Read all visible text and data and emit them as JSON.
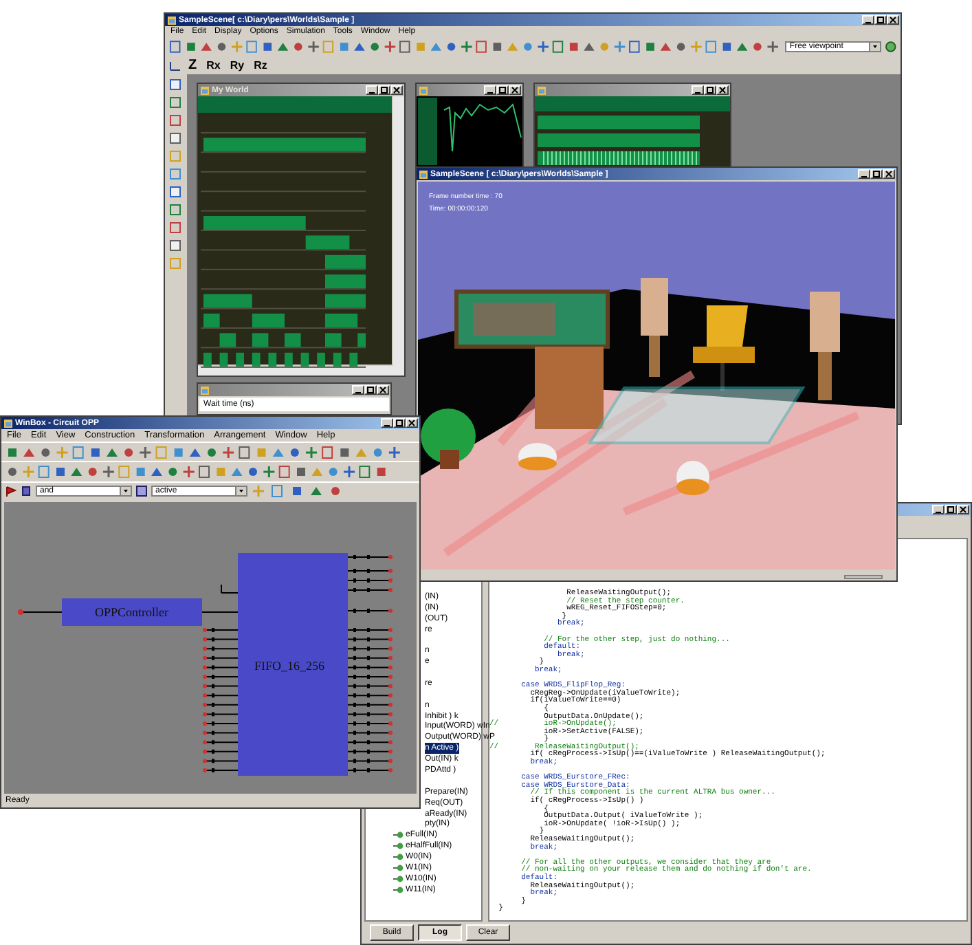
{
  "sim_window": {
    "title": "SampleScene[ c:\\Diary\\pers\\Worlds\\Sample ]",
    "menu": [
      "File",
      "Edit",
      "Display",
      "Options",
      "Simulation",
      "Tools",
      "Window",
      "Help"
    ],
    "viewpoint": "Free viewpoint",
    "axis_buttons": [
      "Z",
      "Rx",
      "Ry",
      "Rz"
    ],
    "wave_window": {
      "title": "My World"
    },
    "watch_panel": {
      "row": "Wait time (ns)"
    }
  },
  "scene_window": {
    "title": "SampleScene [ c:\\Diary\\pers\\Worlds\\Sample ]",
    "overlay": [
      "Frame number time : 70",
      "Time: 00:00:00:120"
    ]
  },
  "code_window": {
    "tree": [
      {
        "label": "(IN)",
        "kind": "label",
        "selected": false
      },
      {
        "label": "(IN)",
        "kind": "label",
        "selected": false
      },
      {
        "label": "(OUT)",
        "kind": "label",
        "selected": false
      },
      {
        "label": "re",
        "kind": "label",
        "selected": false
      },
      {
        "label": "n",
        "kind": "label",
        "selected": false,
        "space_before": true
      },
      {
        "label": "e",
        "kind": "label",
        "selected": false
      },
      {
        "label": "re",
        "kind": "label",
        "selected": false,
        "space_before": true
      },
      {
        "label": "n",
        "kind": "label",
        "selected": false,
        "space_before": true
      },
      {
        "label": "Inhibit ) k",
        "kind": "label",
        "selected": false
      },
      {
        "label": "Input(WORD) wIn",
        "kind": "label",
        "selected": false
      },
      {
        "label": "Output(WORD) wP",
        "kind": "label",
        "selected": false
      },
      {
        "label": "n Active )",
        "kind": "label",
        "selected": true
      },
      {
        "label": "Out(IN) k",
        "kind": "label",
        "selected": false
      },
      {
        "label": "PDAttd )",
        "kind": "label",
        "selected": false
      },
      {
        "label": "Prepare(IN)",
        "kind": "label",
        "selected": false,
        "space_before": true
      },
      {
        "label": "Req(OUT)",
        "kind": "label",
        "selected": false
      },
      {
        "label": "aReady(IN)",
        "kind": "label",
        "selected": false
      },
      {
        "label": "pty(IN)",
        "kind": "label",
        "selected": false
      },
      {
        "label": "eFull(IN)",
        "kind": "port",
        "selected": false
      },
      {
        "label": "eHalfFull(IN)",
        "kind": "port",
        "selected": false
      },
      {
        "label": "W0(IN)",
        "kind": "port",
        "selected": false
      },
      {
        "label": "W1(IN)",
        "kind": "port",
        "selected": false
      },
      {
        "label": "W10(IN)",
        "kind": "port",
        "selected": false
      },
      {
        "label": "W11(IN)",
        "kind": "port",
        "selected": false
      }
    ],
    "code": [
      {
        "text": "                 ReleaseWaitingOutput();",
        "kind": "code"
      },
      {
        "text": "                 // Reset the step counter.",
        "kind": "comment"
      },
      {
        "text": "                 wREG_Reset_FIFOStep=0;",
        "kind": "code"
      },
      {
        "text": "                }",
        "kind": "code"
      },
      {
        "text": "               break;",
        "kind": "keyword"
      },
      {
        "text": "            // For the other step, just do nothing...",
        "kind": "comment",
        "space_before": true
      },
      {
        "text": "            default:",
        "kind": "keyword"
      },
      {
        "text": "               break;",
        "kind": "keyword"
      },
      {
        "text": "           }",
        "kind": "code"
      },
      {
        "text": "          break;",
        "kind": "keyword"
      },
      {
        "text": "       case WRDS_FlipFlop_Reg:",
        "kind": "keyword",
        "space_before": true
      },
      {
        "text": "         cRegReg->OnUpdate(iValueToWrite);",
        "kind": "code"
      },
      {
        "text": "         if(iValueToWrite==0)",
        "kind": "code"
      },
      {
        "text": "            {",
        "kind": "code"
      },
      {
        "text": "            OutputData.OnUpdate();",
        "kind": "code"
      },
      {
        "text": "//          ioR->OnUpdate();",
        "kind": "comment"
      },
      {
        "text": "            ioR->SetActive(FALSE);",
        "kind": "code"
      },
      {
        "text": "            }",
        "kind": "code"
      },
      {
        "text": "//        ReleaseWaitingOutput();",
        "kind": "comment"
      },
      {
        "text": "         if( cRegProcess->IsUp()==(iValueToWrite ) ReleaseWaitingOutput();",
        "kind": "code"
      },
      {
        "text": "         break;",
        "kind": "keyword"
      },
      {
        "text": "       case WRDS_Eurstore_FRec:",
        "kind": "keyword",
        "space_before": true
      },
      {
        "text": "       case WRDS_Eurstore_Data:",
        "kind": "keyword"
      },
      {
        "text": "         // If this component is the current ALTRA bus owner...",
        "kind": "comment"
      },
      {
        "text": "         if( cRegProcess->IsUp() )",
        "kind": "code"
      },
      {
        "text": "            {",
        "kind": "code"
      },
      {
        "text": "            OutputData.Output( iValueToWrite );",
        "kind": "code"
      },
      {
        "text": "            ioR->OnUpdate( !ioR->IsUp() );",
        "kind": "code"
      },
      {
        "text": "           }",
        "kind": "code"
      },
      {
        "text": "         ReleaseWaitingOutput();",
        "kind": "code"
      },
      {
        "text": "         break;",
        "kind": "keyword"
      },
      {
        "text": "       // For all the other outputs, we consider that they are",
        "kind": "comment",
        "space_before": true
      },
      {
        "text": "       // non-waiting on your release them and do nothing if don't are.",
        "kind": "comment"
      },
      {
        "text": "       default:",
        "kind": "keyword"
      },
      {
        "text": "         ReleaseWaitingOutput();",
        "kind": "code"
      },
      {
        "text": "         break;",
        "kind": "keyword"
      },
      {
        "text": "       }",
        "kind": "code"
      },
      {
        "text": "  }",
        "kind": "code"
      }
    ],
    "buttons": [
      {
        "label": "Build",
        "selected": false
      },
      {
        "label": "Log",
        "selected": true
      },
      {
        "label": "Clear",
        "selected": false
      }
    ]
  },
  "circuit_window": {
    "title": "WinBox - Circuit OPP",
    "menu": [
      "File",
      "Edit",
      "View",
      "Construction",
      "Transformation",
      "Arrangement",
      "Window",
      "Help"
    ],
    "combo_1": "and",
    "combo_2": "active",
    "blocks": [
      "OPPController",
      "FIFO_16_256"
    ],
    "status": "Ready"
  }
}
